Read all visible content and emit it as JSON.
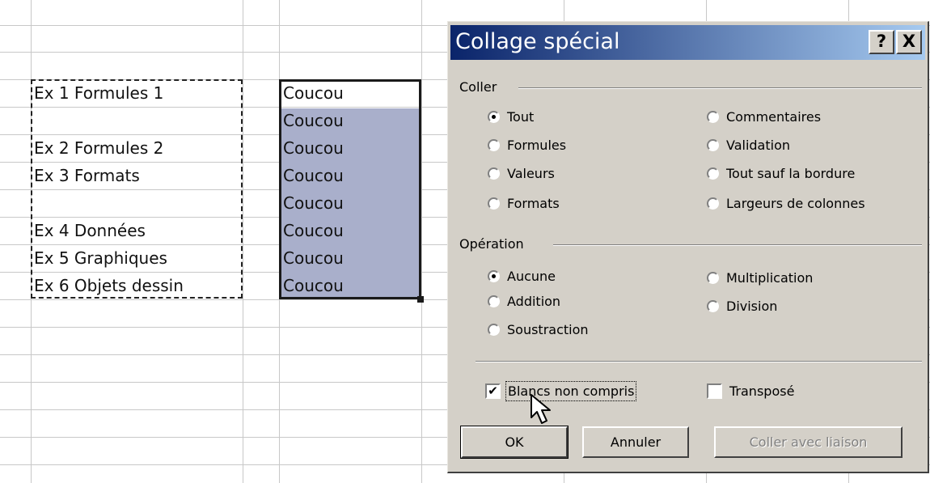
{
  "sheet": {
    "left_cells": [
      "Ex 1 Formules 1",
      "Ex 2 Formules 2",
      "Ex 3 Formats",
      "Ex 4 Données",
      "Ex 5 Graphiques",
      "Ex 6 Objets dessin"
    ],
    "right_cells": [
      "Coucou",
      "Coucou",
      "Coucou",
      "Coucou",
      "Coucou",
      "Coucou",
      "Coucou",
      "Coucou"
    ],
    "selection_color": "#a9afcb"
  },
  "dialog": {
    "title": "Collage spécial",
    "help_button": "?",
    "close_button": "X",
    "coller": {
      "label": "Coller",
      "options": [
        {
          "label": "Tout",
          "checked": true
        },
        {
          "label": "Formules",
          "checked": false
        },
        {
          "label": "Valeurs",
          "checked": false
        },
        {
          "label": "Formats",
          "checked": false
        },
        {
          "label": "Commentaires",
          "checked": false
        },
        {
          "label": "Validation",
          "checked": false
        },
        {
          "label": "Tout sauf la bordure",
          "checked": false
        },
        {
          "label": "Largeurs de colonnes",
          "checked": false
        }
      ]
    },
    "operation": {
      "label": "Opération",
      "options": [
        {
          "label": "Aucune",
          "checked": true
        },
        {
          "label": "Addition",
          "checked": false
        },
        {
          "label": "Soustraction",
          "checked": false
        },
        {
          "label": "Multiplication",
          "checked": false
        },
        {
          "label": "Division",
          "checked": false
        }
      ]
    },
    "blancs_non_compris": {
      "label": "Blancs non compris",
      "checked": true
    },
    "transpose": {
      "label": "Transposé",
      "checked": false
    },
    "buttons": {
      "ok": "OK",
      "annuler": "Annuler",
      "coller_liaison": "Coller avec liaison"
    },
    "title_color": "#0a246a",
    "face_color": "#d4d0c8"
  }
}
